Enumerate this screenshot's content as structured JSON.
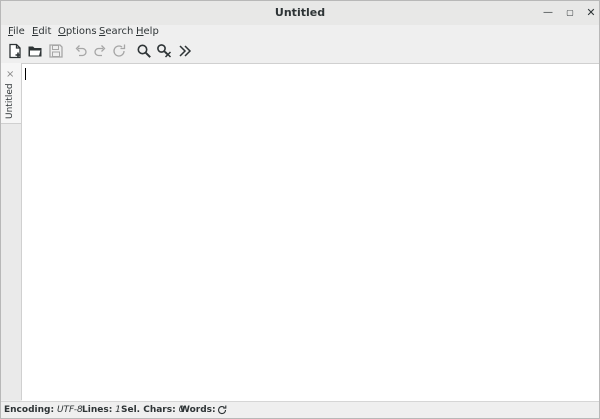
{
  "window": {
    "title": "Untitled",
    "controls": [
      "minimize-icon",
      "maximize-icon",
      "close-icon"
    ]
  },
  "menubar": {
    "items": [
      {
        "label": "File"
      },
      {
        "label": "Edit"
      },
      {
        "label": "Options"
      },
      {
        "label": "Search"
      },
      {
        "label": "Help"
      }
    ]
  },
  "toolbar": {
    "buttons": [
      {
        "icon": "new-document-icon"
      },
      {
        "icon": "open-folder-icon"
      },
      {
        "icon": "save-icon"
      },
      {
        "icon": "undo-icon"
      },
      {
        "icon": "redo-icon"
      },
      {
        "icon": "reload-icon"
      },
      {
        "icon": "search-icon"
      },
      {
        "icon": "cut-icon"
      },
      {
        "icon": "more-icon"
      }
    ]
  },
  "tabs": [
    {
      "label": "Untitled",
      "close_glyph": "×"
    }
  ],
  "statusbar": {
    "encoding_label": "Encoding:",
    "encoding_value": "UTF-8",
    "lines_label": "Lines:",
    "lines_value": "1",
    "sel_chars_label": "Sel. Chars:",
    "sel_chars_value": "0",
    "words_label": "Words:"
  },
  "colors": {
    "chrome": "#efefef",
    "editor_bg": "#ffffff",
    "text": "#2e3436"
  }
}
